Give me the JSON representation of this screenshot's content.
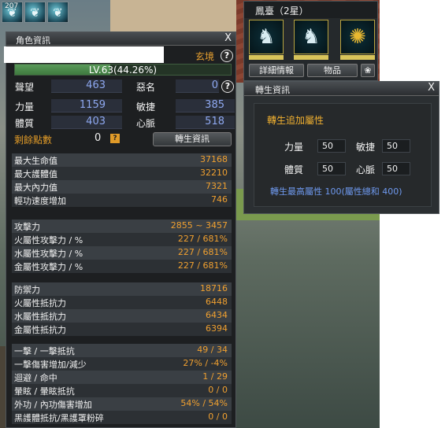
{
  "skills": {
    "count": "207",
    "icons": [
      "wing-skill-icon",
      "wing-skill-icon",
      "wing-skill-icon"
    ]
  },
  "character_panel": {
    "title": "角色資訊",
    "close_label": "X",
    "name": "",
    "realm": "玄境",
    "help": "?",
    "level_text": "LV.63(44.26%)",
    "level_progress": 0.4426,
    "stats": {
      "reputation_label": "聲望",
      "reputation_value": "463",
      "infamy_label": "惡名",
      "infamy_value": "0",
      "strength_label": "力量",
      "strength_value": "1159",
      "agility_label": "敏捷",
      "agility_value": "385",
      "constitution_label": "體質",
      "constitution_value": "403",
      "meridian_label": "心脈",
      "meridian_value": "518"
    },
    "remaining_points_label": "剩餘點數",
    "remaining_points_value": "0",
    "reborn_button": "轉生資訊",
    "group_hp": [
      {
        "label": "最大生命值",
        "value": "37168"
      },
      {
        "label": "最大護體值",
        "value": "32210"
      },
      {
        "label": "最大內力值",
        "value": "7321"
      },
      {
        "label": "輕功速度增加",
        "value": "746"
      }
    ],
    "group_attack": [
      {
        "label": "攻擊力",
        "value": "2855 ~ 3457"
      },
      {
        "label": "火屬性攻擊力 / %",
        "value": "227 / 681%"
      },
      {
        "label": "水屬性攻擊力 / %",
        "value": "227 / 681%"
      },
      {
        "label": "金屬性攻擊力 / %",
        "value": "227 / 681%"
      }
    ],
    "group_defense": [
      {
        "label": "防禦力",
        "value": "18716"
      },
      {
        "label": "火屬性抵抗力",
        "value": "6448"
      },
      {
        "label": "水屬性抵抗力",
        "value": "6434"
      },
      {
        "label": "金屬性抵抗力",
        "value": "6394"
      }
    ],
    "group_misc": [
      {
        "label": "一擊 / 一擊抵抗",
        "value": "49 / 34"
      },
      {
        "label": "一擊傷害增加/減少",
        "value": "27% / -4%"
      },
      {
        "label": "迴避 / 命中",
        "value": "1 / 29"
      },
      {
        "label": "暈眩 / 暈眩抵抗",
        "value": "0 / 0"
      },
      {
        "label": "外功 / 內功傷害增加",
        "value": "54% / 54%"
      },
      {
        "label": "黑護體抵抗/黑護罩粉碎",
        "value": "0 / 0"
      }
    ]
  },
  "status_panel": {
    "title": "鳳臺（2星）",
    "detail_button": "詳細情報",
    "items_button": "物品",
    "pet_icons": [
      "dragon-icon",
      "dragon-icon",
      "sun-emblem-icon"
    ]
  },
  "reborn_panel": {
    "title": "轉生資訊",
    "close_label": "X",
    "heading": "轉生追加屬性",
    "strength_label": "力量",
    "strength_value": "50",
    "agility_label": "敏捷",
    "agility_value": "50",
    "constitution_label": "體質",
    "constitution_value": "50",
    "meridian_label": "心脈",
    "meridian_value": "50",
    "note": "轉生最高屬性 100(屬性總和 400)"
  },
  "colors": {
    "panel_bg": "#1d1f21",
    "value_orange": "#f0a030",
    "value_blue": "#8ea8f0",
    "level_bar": "#4a8a4a",
    "note_blue": "#6f9af0"
  }
}
